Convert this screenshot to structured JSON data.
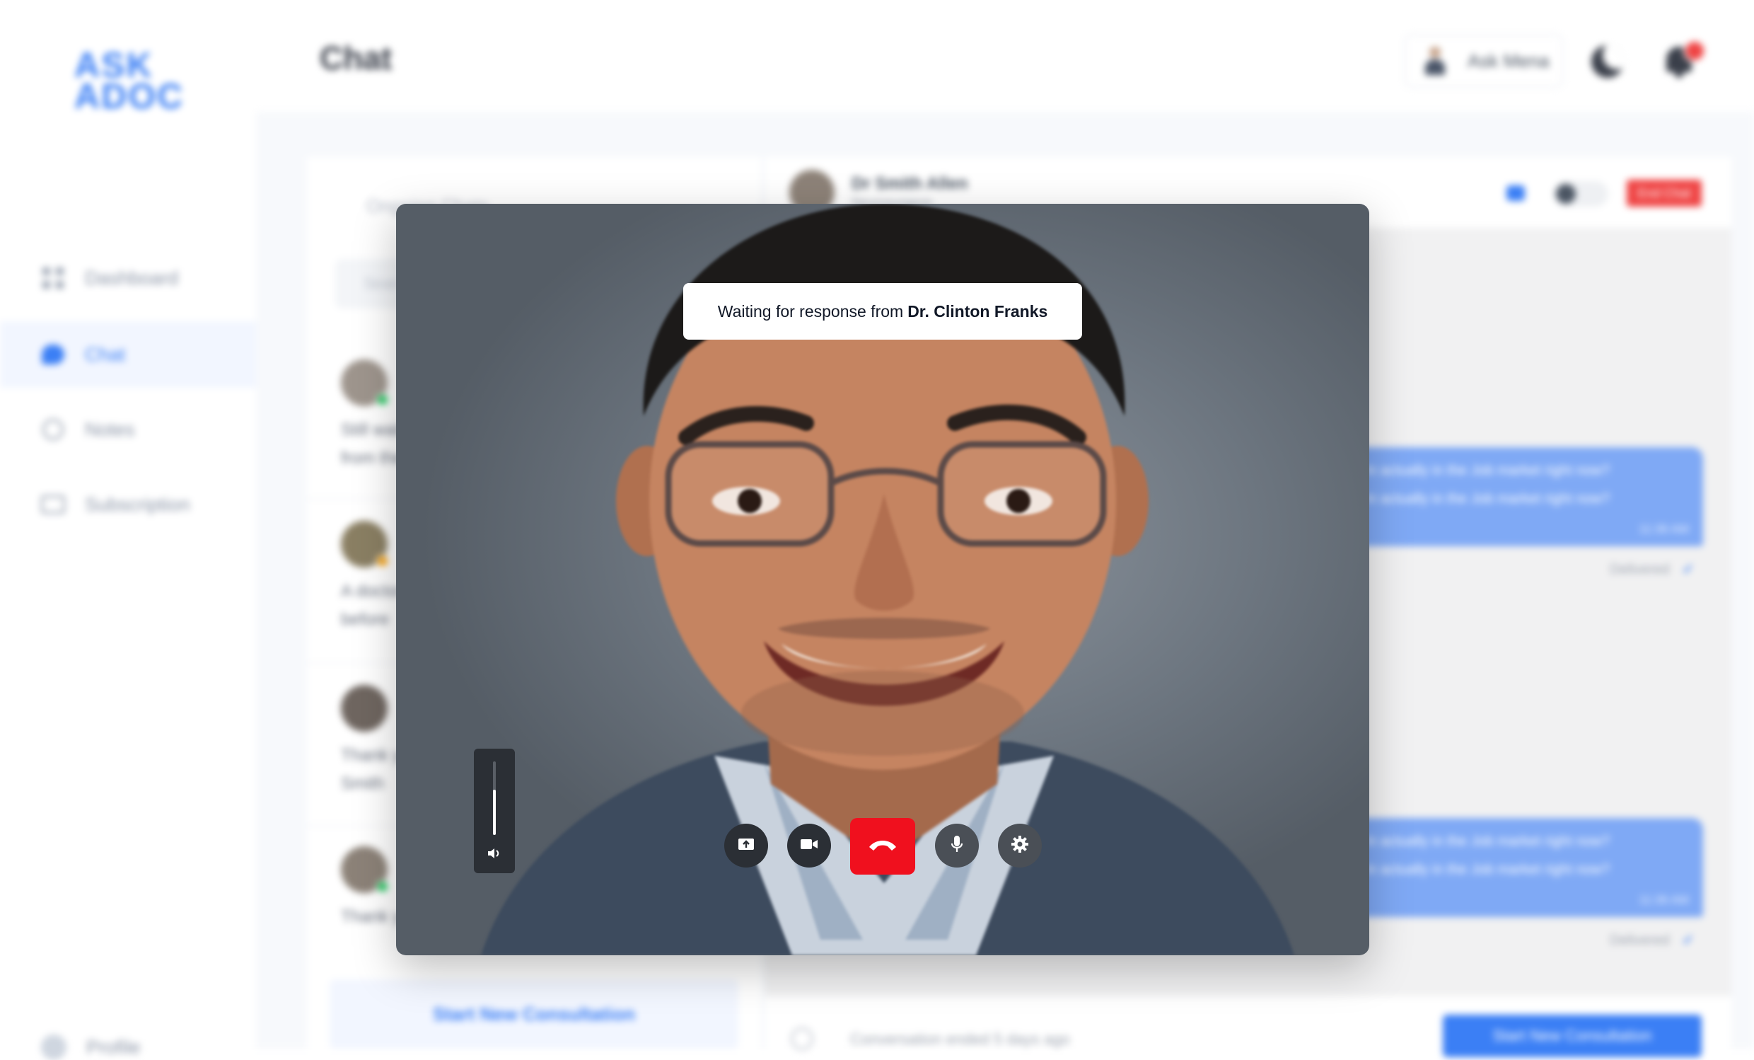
{
  "app": {
    "logo_line1": "ASK",
    "logo_line2": "ADOC",
    "page_title": "Chat"
  },
  "sidebar": {
    "items": [
      {
        "label": "Dashboard"
      },
      {
        "label": "Chat"
      },
      {
        "label": "Notes"
      },
      {
        "label": "Subscription"
      }
    ],
    "profile_label": "Profile"
  },
  "header": {
    "ask_label": "Ask Mena"
  },
  "chat_list": {
    "tabs_label": "Ongoing Chats",
    "search_placeholder": "Search",
    "items": [
      {
        "line1": "Still waiting",
        "line2": "from the"
      },
      {
        "line1": "A doctor",
        "line2": "before"
      },
      {
        "line1": "Thank you",
        "line2": "Smith"
      },
      {
        "line1": "Thank you",
        "line2": ""
      }
    ],
    "start_button": "Start New Consultation"
  },
  "chat": {
    "doctor_name": "Dr Smith Allen",
    "doctor_role": "Neurosurgeon",
    "end_chat": "End Chat",
    "messages": [
      {
        "line1": "I'm actually in the Job market right now?",
        "line2": "I'm actually in the Job market right now?",
        "time": "11:36 AM",
        "status": "Delivered"
      },
      {
        "line1": "I'm actually in the Job market right now?",
        "line2": "I'm actually in the Job market right now?",
        "time": "11:36 AM",
        "status": "Delivered"
      }
    ],
    "footer_text": "Conversation ended 5 days ago",
    "footer_button": "Start New Consultation"
  },
  "call": {
    "status_prefix": "Waiting for response from",
    "callee": "Dr. Clinton Franks",
    "volume_fraction": 0.62
  },
  "colors": {
    "brand": "#3b7ff5",
    "hangup": "#f0101e",
    "danger": "#ef4444"
  }
}
